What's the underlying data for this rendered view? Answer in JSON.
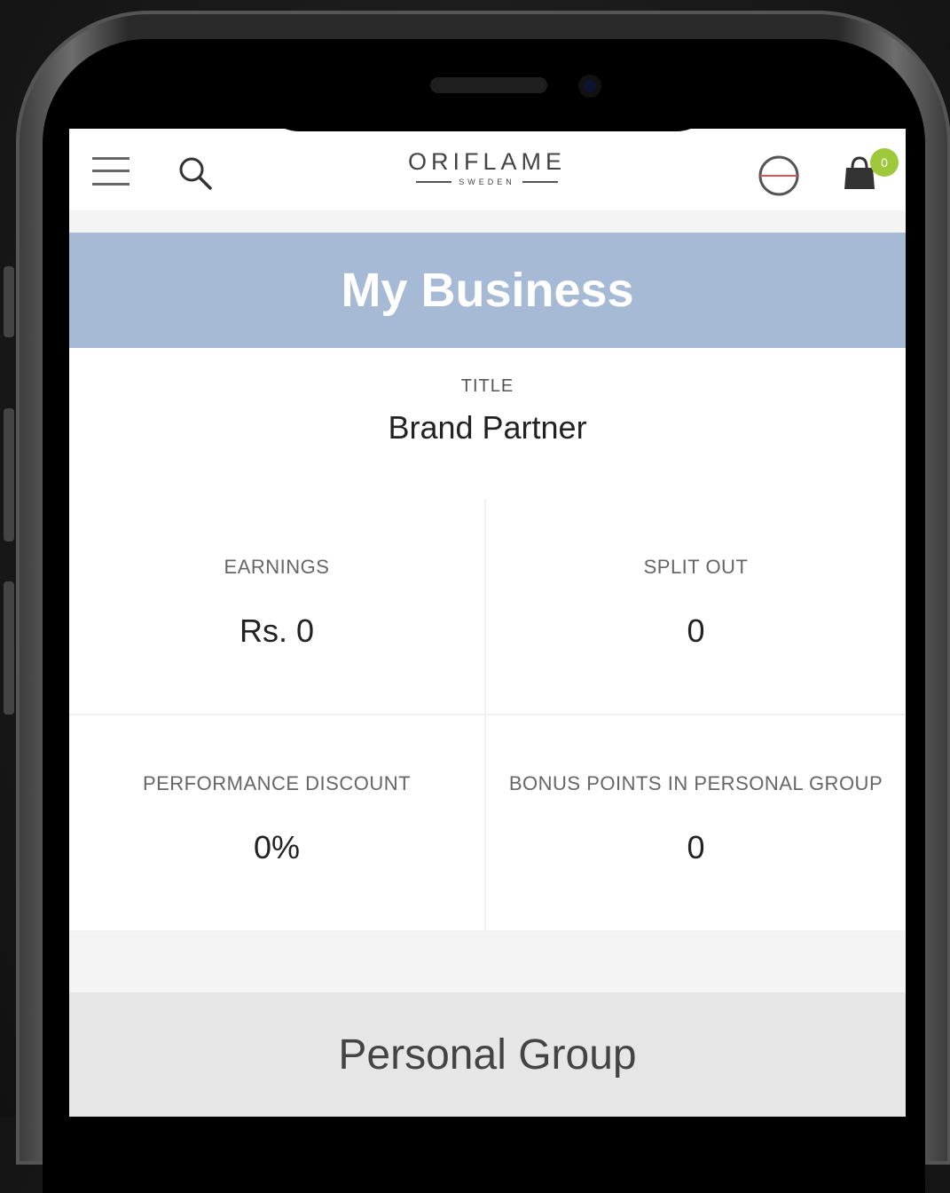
{
  "topbar": {
    "menu_icon": "hamburger-menu-icon",
    "search_icon": "search-icon",
    "brand_name": "ORIFLAME",
    "brand_subtitle": "SWEDEN",
    "profile_icon": "user-profile-icon",
    "cart_icon": "shopping-bag-icon",
    "cart_count": "0",
    "badge_color": "#9ec93a"
  },
  "header": {
    "title": "My Business",
    "color": "#a6bad6"
  },
  "title_block": {
    "label": "TITLE",
    "value": "Brand Partner"
  },
  "stats": [
    {
      "label": "EARNINGS",
      "value": "Rs. 0"
    },
    {
      "label": "SPLIT OUT",
      "value": "0"
    },
    {
      "label": "PERFORMANCE DISCOUNT",
      "value": "0%"
    },
    {
      "label": "BONUS POINTS IN PERSONAL GROUP",
      "value": "0"
    }
  ],
  "section": {
    "title": "Personal Group"
  }
}
